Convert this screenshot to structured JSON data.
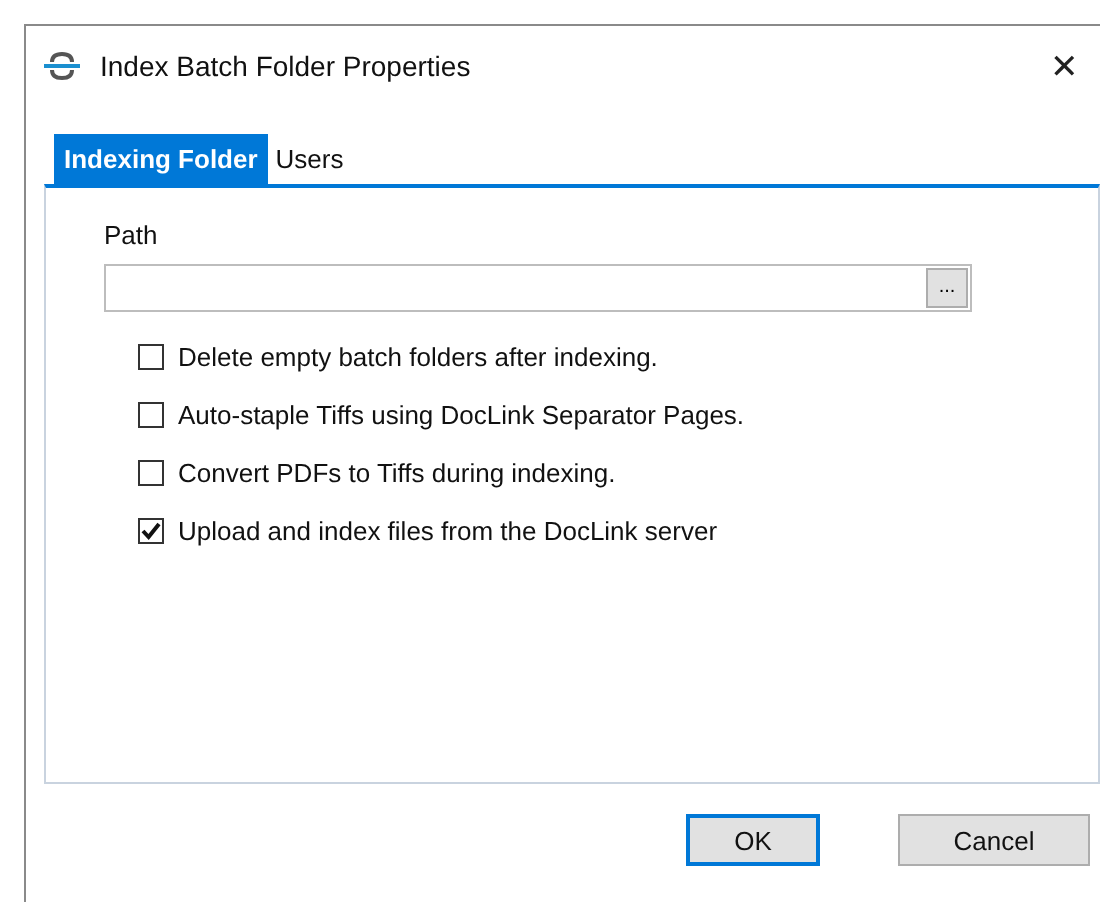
{
  "window": {
    "title": "Index Batch Folder Properties",
    "close": "✕"
  },
  "tabs": [
    {
      "label": "Indexing Folder",
      "selected": true
    },
    {
      "label": "Users",
      "selected": false
    }
  ],
  "path": {
    "label": "Path",
    "browse": "..."
  },
  "options": [
    {
      "label": "Delete empty batch folders after indexing.",
      "checked": false
    },
    {
      "label": "Auto-staple Tiffs using DocLink Separator Pages.",
      "checked": false
    },
    {
      "label": "Convert PDFs to Tiffs during indexing.",
      "checked": false
    },
    {
      "label": "Upload and index files from the DocLink server",
      "checked": true
    }
  ],
  "buttons": [
    {
      "label": "OK",
      "default": true
    },
    {
      "label": "Cancel",
      "default": false
    }
  ]
}
